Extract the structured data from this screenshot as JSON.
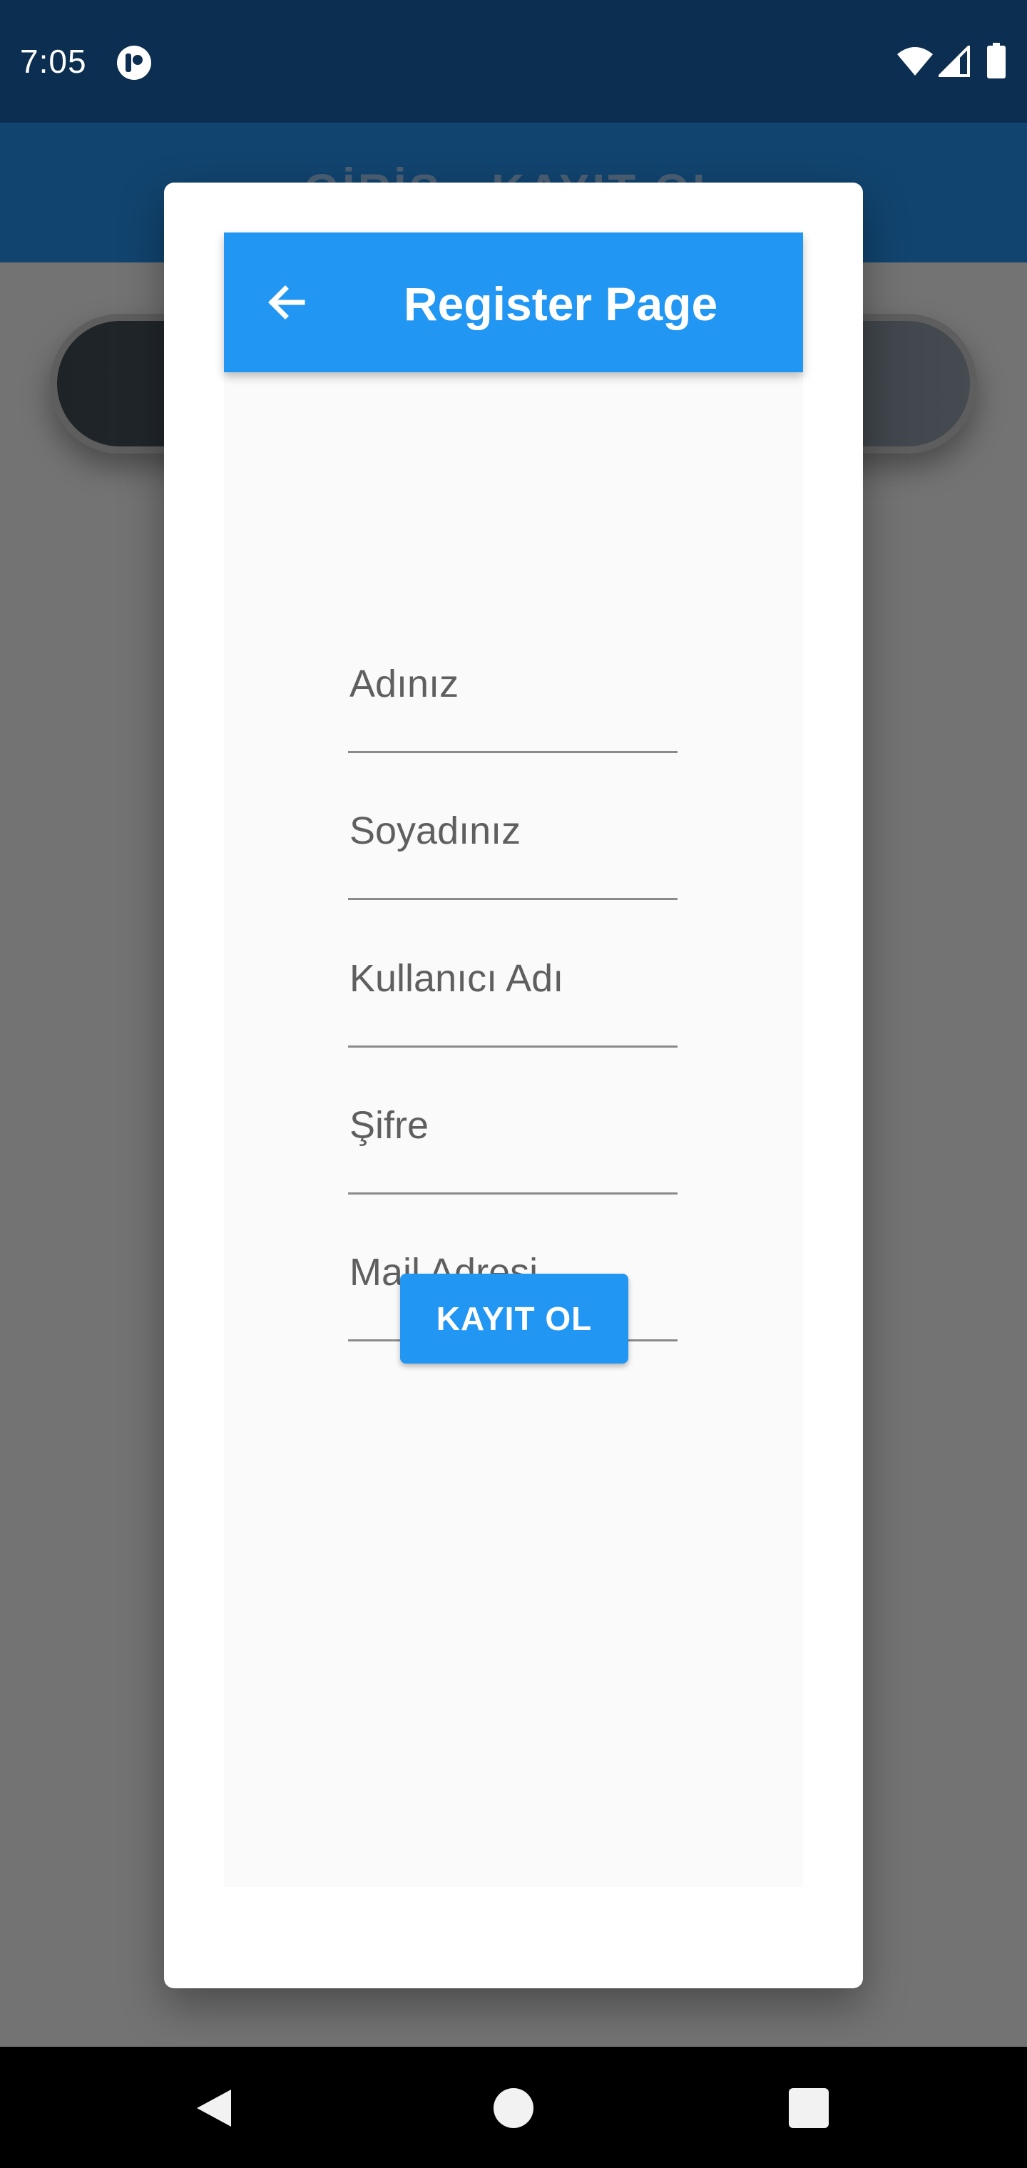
{
  "status_bar": {
    "time": "7:05",
    "icons": [
      "app-notification-icon",
      "wifi-icon",
      "cell-signal-icon",
      "battery-icon"
    ]
  },
  "background_app": {
    "title": "GİRİŞ - KAYIT OL"
  },
  "dialog": {
    "appbar": {
      "back_icon": "arrow-back-icon",
      "title": "Register Page"
    },
    "form": {
      "fields": [
        {
          "label": "Adınız"
        },
        {
          "label": "Soyadınız"
        },
        {
          "label": "Kullanıcı Adı"
        },
        {
          "label": "Şifre"
        },
        {
          "label": "Mail Adresi"
        }
      ],
      "submit_label": "KAYIT OL"
    }
  },
  "nav_bar": {
    "icons": [
      "back-triangle-icon",
      "home-circle-icon",
      "recents-square-icon"
    ]
  },
  "colors": {
    "status_bar": "#0c2e50",
    "appbar": "#2196f3",
    "button": "#2196f3",
    "scrim": "#737373"
  }
}
